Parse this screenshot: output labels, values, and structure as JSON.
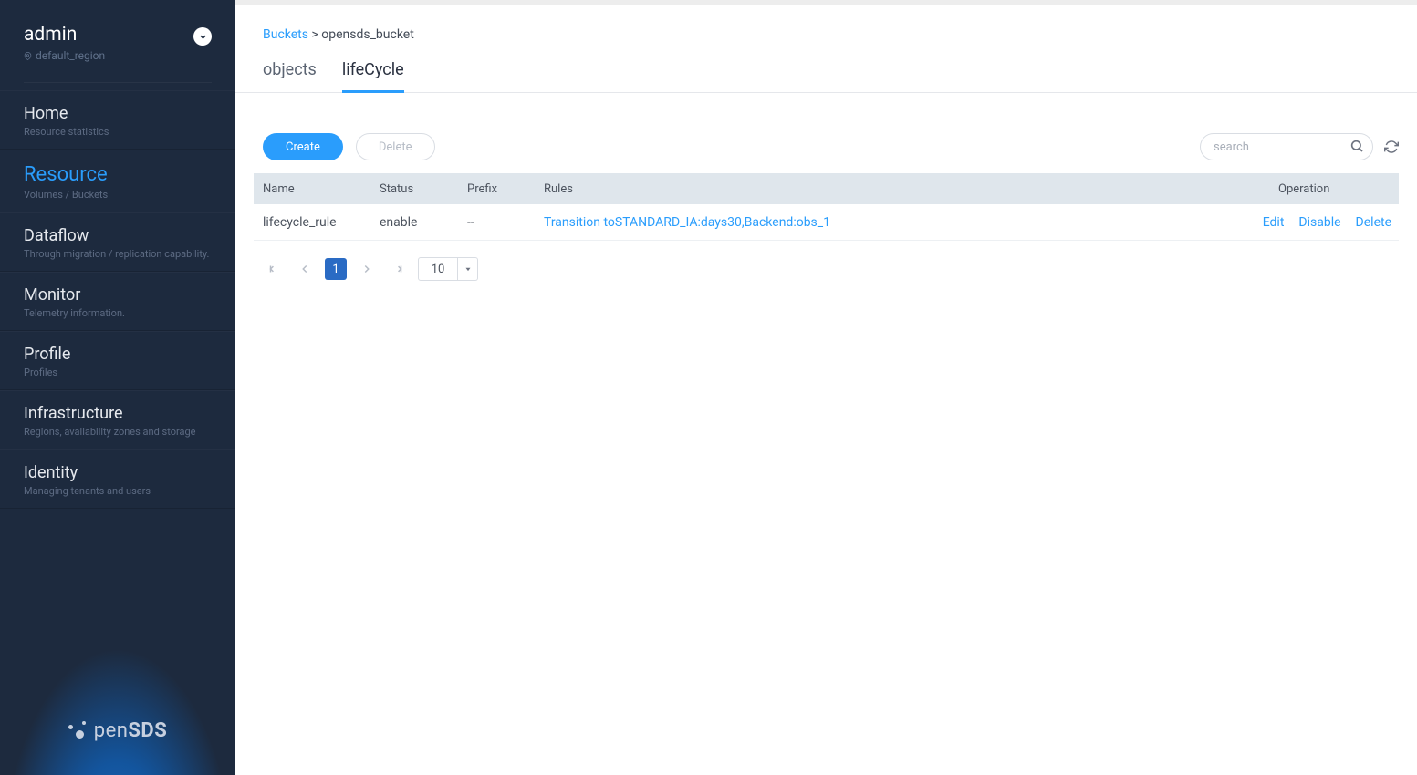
{
  "user": {
    "name": "admin",
    "region": "default_region"
  },
  "nav": [
    {
      "title": "Home",
      "sub": "Resource statistics"
    },
    {
      "title": "Resource",
      "sub": "Volumes / Buckets",
      "active": true
    },
    {
      "title": "Dataflow",
      "sub": "Through migration / replication capability."
    },
    {
      "title": "Monitor",
      "sub": "Telemetry information."
    },
    {
      "title": "Profile",
      "sub": "Profiles"
    },
    {
      "title": "Infrastructure",
      "sub": "Regions, availability zones and storage"
    },
    {
      "title": "Identity",
      "sub": "Managing tenants and users"
    }
  ],
  "logo": {
    "prefix": "pen",
    "strong": "SDS"
  },
  "breadcrumb": {
    "root": "Buckets",
    "sep": ">",
    "current": "opensds_bucket"
  },
  "tabs": [
    {
      "label": "objects",
      "active": false
    },
    {
      "label": "lifeCycle",
      "active": true
    }
  ],
  "buttons": {
    "create": "Create",
    "delete": "Delete"
  },
  "search": {
    "placeholder": "search"
  },
  "columns": {
    "name": "Name",
    "status": "Status",
    "prefix": "Prefix",
    "rules": "Rules",
    "operation": "Operation"
  },
  "rows": [
    {
      "name": "lifecycle_rule",
      "status": "enable",
      "prefix": "--",
      "rules": "Transition toSTANDARD_IA:days30,Backend:obs_1"
    }
  ],
  "op": {
    "edit": "Edit",
    "disable": "Disable",
    "delete": "Delete"
  },
  "pager": {
    "current": "1",
    "size": "10"
  }
}
